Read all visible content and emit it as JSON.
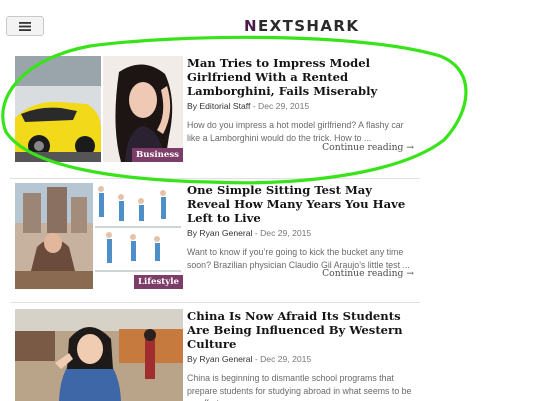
{
  "header": {
    "menu_icon": "hamburger-icon",
    "logo_first": "N",
    "logo_rest": "EXTSHARK"
  },
  "articles": [
    {
      "headline": "Man Tries to Impress Model Girlfriend With a Rented Lamborghini, Fails Miserably",
      "author": "By Editorial Staff",
      "separator": " - ",
      "date": "Dec 29, 2015",
      "excerpt": "How do you impress a hot model girlfriend? A flashy car like a Lamborghini would do the trick. How to ...",
      "continue": "Continue reading →",
      "category": "Business"
    },
    {
      "headline": "One Simple Sitting Test May Reveal How Many Years You Have Left to Live",
      "author": "By Ryan General",
      "separator": " - ",
      "date": "Dec 29, 2015",
      "excerpt": "Want to know if you’re going to kick the bucket any time soon? Brazilian physician Claudio Gil Araujo’s little test ...",
      "continue": "Continue reading →",
      "category": "Lifestyle"
    },
    {
      "headline": "China Is Now Afraid Its Students Are Being Influenced By Western Culture",
      "author": "By Ryan General",
      "separator": " - ",
      "date": "Dec 29, 2015",
      "excerpt": "China is beginning to dismantle school programs that prepare students for studying abroad in what seems to be an effort ..."
    }
  ],
  "annotation": {
    "color": "#39e31a"
  },
  "colors": {
    "badge": "#7c3d68",
    "logo_accent": "#4a1c4a"
  }
}
